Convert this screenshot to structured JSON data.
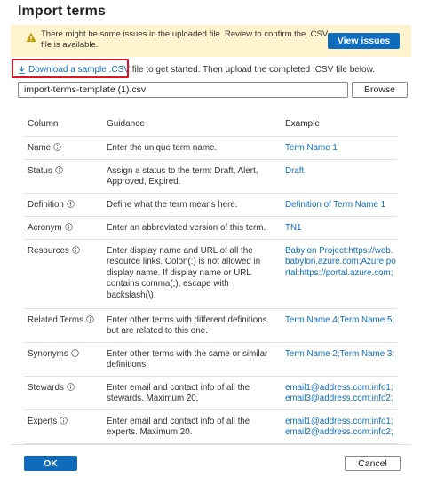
{
  "dialog": {
    "title": "Import terms"
  },
  "warning": {
    "icon": "warning-icon",
    "text": "There might be some issues in the uploaded file. Review to confirm the .CSV file is available.",
    "button_label": "View issues",
    "background": "#fff4ce",
    "icon_color": "#c19c00"
  },
  "download": {
    "icon": "download-icon",
    "link_label": "Download a sample .CSV",
    "rest_text": " file to get started. Then upload the completed .CSV file below."
  },
  "file": {
    "value": "import-terms-template (1).csv",
    "browse_label": "Browse"
  },
  "table": {
    "headers": {
      "column": "Column",
      "guidance": "Guidance",
      "example": "Example"
    },
    "rows": [
      {
        "column": "Name",
        "guidance": "Enter the unique term name.",
        "example": "Term Name 1"
      },
      {
        "column": "Status",
        "guidance": "Assign a status to the term: Draft, Alert, Approved, Expired.",
        "example": "Draft"
      },
      {
        "column": "Definition",
        "guidance": "Define what the term means here.",
        "example": "Definition of Term Name 1"
      },
      {
        "column": "Acronym",
        "guidance": "Enter an abbreviated version of this term.",
        "example": "TN1"
      },
      {
        "column": "Resources",
        "guidance": "Enter display name and URL of all the resource links. Colon(:) is not allowed in display name. If display name or URL contains comma(;), escape with backslash(\\).",
        "example": "Babylon Project:https://web.babylon.azure.com;Azure portal:https://portal.azure.com;"
      },
      {
        "column": "Related Terms",
        "guidance": "Enter other terms with different definitions but are related to this one.",
        "example": "Term Name 4;Term Name 5;"
      },
      {
        "column": "Synonyms",
        "guidance": "Enter other terms with the same or similar definitions.",
        "example": "Term Name 2;Term Name 3;"
      },
      {
        "column": "Stewards",
        "guidance": "Enter email and contact info of all the stewards. Maximum 20.",
        "example": "email1@address.com:info1;email3@address.com:info2;"
      },
      {
        "column": "Experts",
        "guidance": "Enter email and contact info of all the experts. Maximum 20.",
        "example": "email1@address.com:info1;email2@address.com:info2;"
      }
    ]
  },
  "footer": {
    "ok_label": "OK",
    "cancel_label": "Cancel"
  },
  "colors": {
    "accent": "#0f6cbd",
    "highlight": "#e81123",
    "warning_bg": "#fff4ce"
  }
}
